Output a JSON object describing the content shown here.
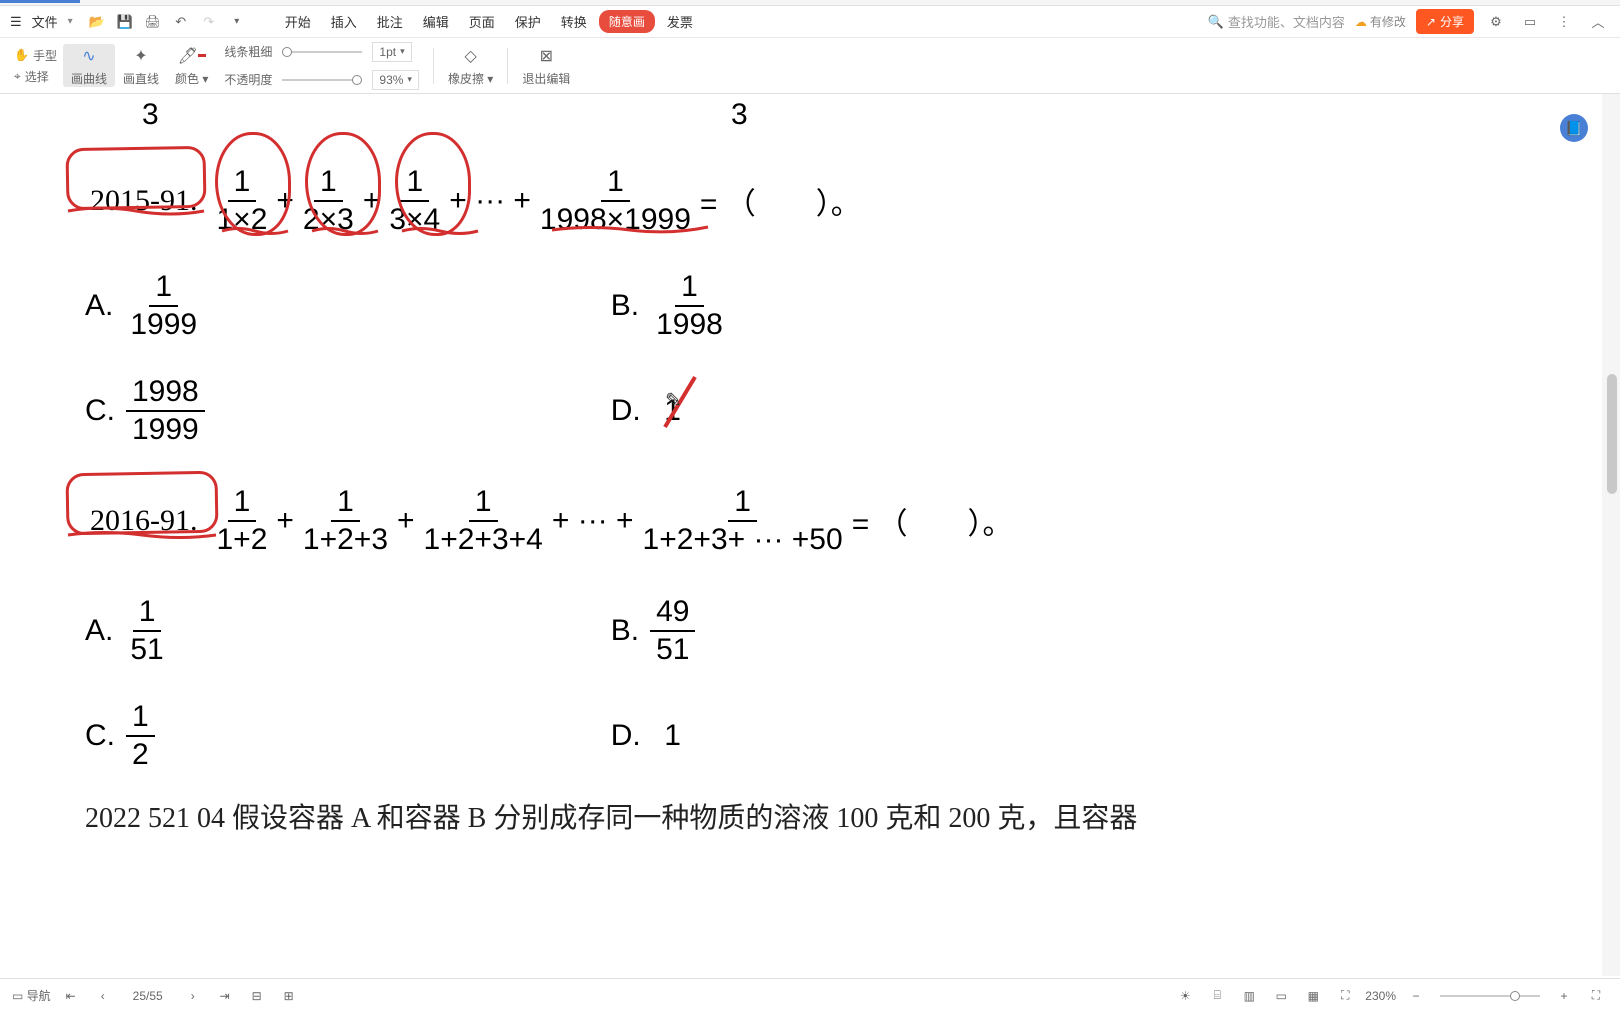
{
  "menu": {
    "file": "文件",
    "start": "开始",
    "insert": "插入",
    "comment": "批注",
    "edit": "编辑",
    "page": "页面",
    "protect": "保护",
    "convert": "转换",
    "draw": "随意画",
    "invoice": "发票",
    "search_placeholder": "查找功能、文档内容",
    "has_changes": "有修改",
    "share": "分享"
  },
  "ribbon": {
    "hand": "手型",
    "select": "选择",
    "curve": "画曲线",
    "line": "画直线",
    "color": "颜色",
    "thickness": "线条粗细",
    "opacity": "不透明度",
    "pt_value": "1pt",
    "opacity_value": "93%",
    "eraser": "橡皮擦",
    "exit": "退出编辑"
  },
  "content": {
    "top_frac_left": "3",
    "top_frac_right": "3",
    "q1_num": "2015-91.",
    "q1_f1_num": "1",
    "q1_f1_den": "1×2",
    "q1_f2_num": "1",
    "q1_f2_den": "2×3",
    "q1_f3_num": "1",
    "q1_f3_den": "3×4",
    "q1_dots": "+ ··· +",
    "q1_f4_num": "1",
    "q1_f4_den": "1998×1999",
    "q1_eq": " = （　　）。",
    "q1_A_label": "A.",
    "q1_A_num": "1",
    "q1_A_den": "1999",
    "q1_B_label": "B.",
    "q1_B_num": "1",
    "q1_B_den": "1998",
    "q1_C_label": "C.",
    "q1_C_num": "1998",
    "q1_C_den": "1999",
    "q1_D_label": "D.",
    "q1_D_val": "1",
    "q2_num": "2016-91.",
    "q2_f1_num": "1",
    "q2_f1_den": "1+2",
    "q2_f2_num": "1",
    "q2_f2_den": "1+2+3",
    "q2_f3_num": "1",
    "q2_f3_den": "1+2+3+4",
    "q2_dots": "+ ··· +",
    "q2_f4_num": "1",
    "q2_f4_den": "1+2+3+ ··· +50",
    "q2_eq": " = （　　）。",
    "q2_A_label": "A.",
    "q2_A_num": "1",
    "q2_A_den": "51",
    "q2_B_label": "B.",
    "q2_B_num": "49",
    "q2_B_den": "51",
    "q2_C_label": "C.",
    "q2_C_num": "1",
    "q2_C_den": "2",
    "q2_D_label": "D.",
    "q2_D_val": "1",
    "bottom_partial": "2022 521 04 假设容器 A 和容器 B 分别成存同一种物质的溶液 100 克和 200 克，且容器"
  },
  "status": {
    "nav": "导航",
    "page": "25/55",
    "zoom": "230%"
  }
}
